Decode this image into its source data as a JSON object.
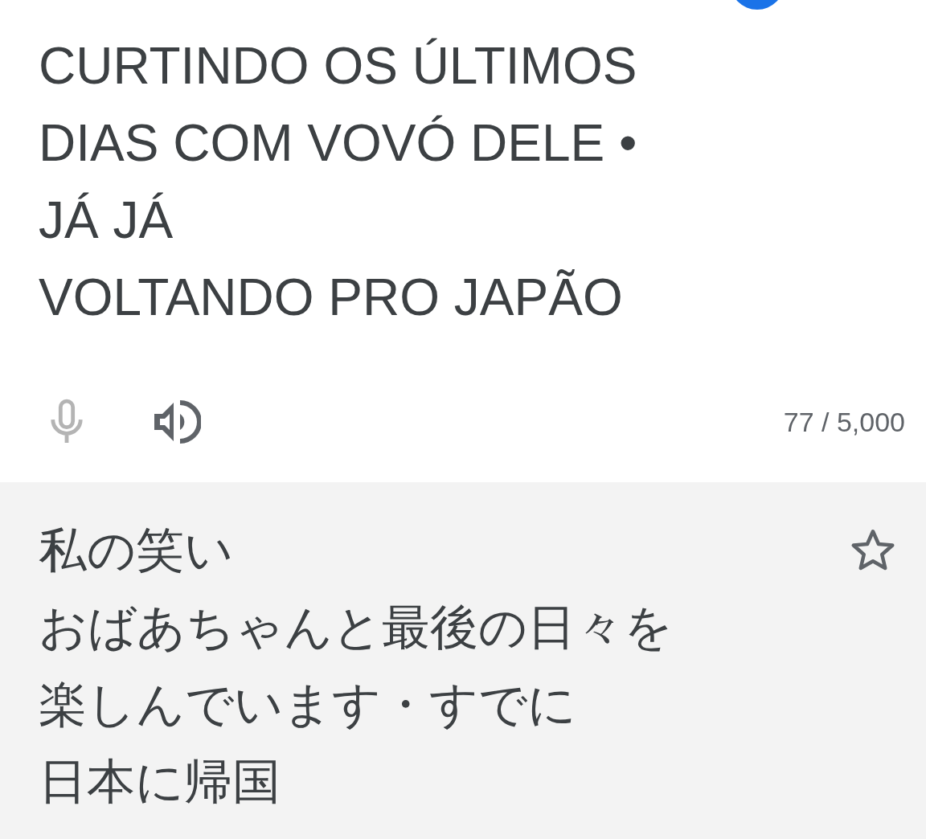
{
  "source": {
    "lines": [
      "CURTINDO OS ÚLTIMOS",
      "DIAS COM VOVÓ DELE •",
      "JÁ JÁ",
      "VOLTANDO PRO JAPÃO"
    ],
    "char_count": "77 / 5,000"
  },
  "translation": {
    "lines": [
      "私の笑い",
      "おばあちゃんと最後の日々を",
      "楽しんでいます・すでに",
      "日本に帰国"
    ],
    "starred": false
  }
}
